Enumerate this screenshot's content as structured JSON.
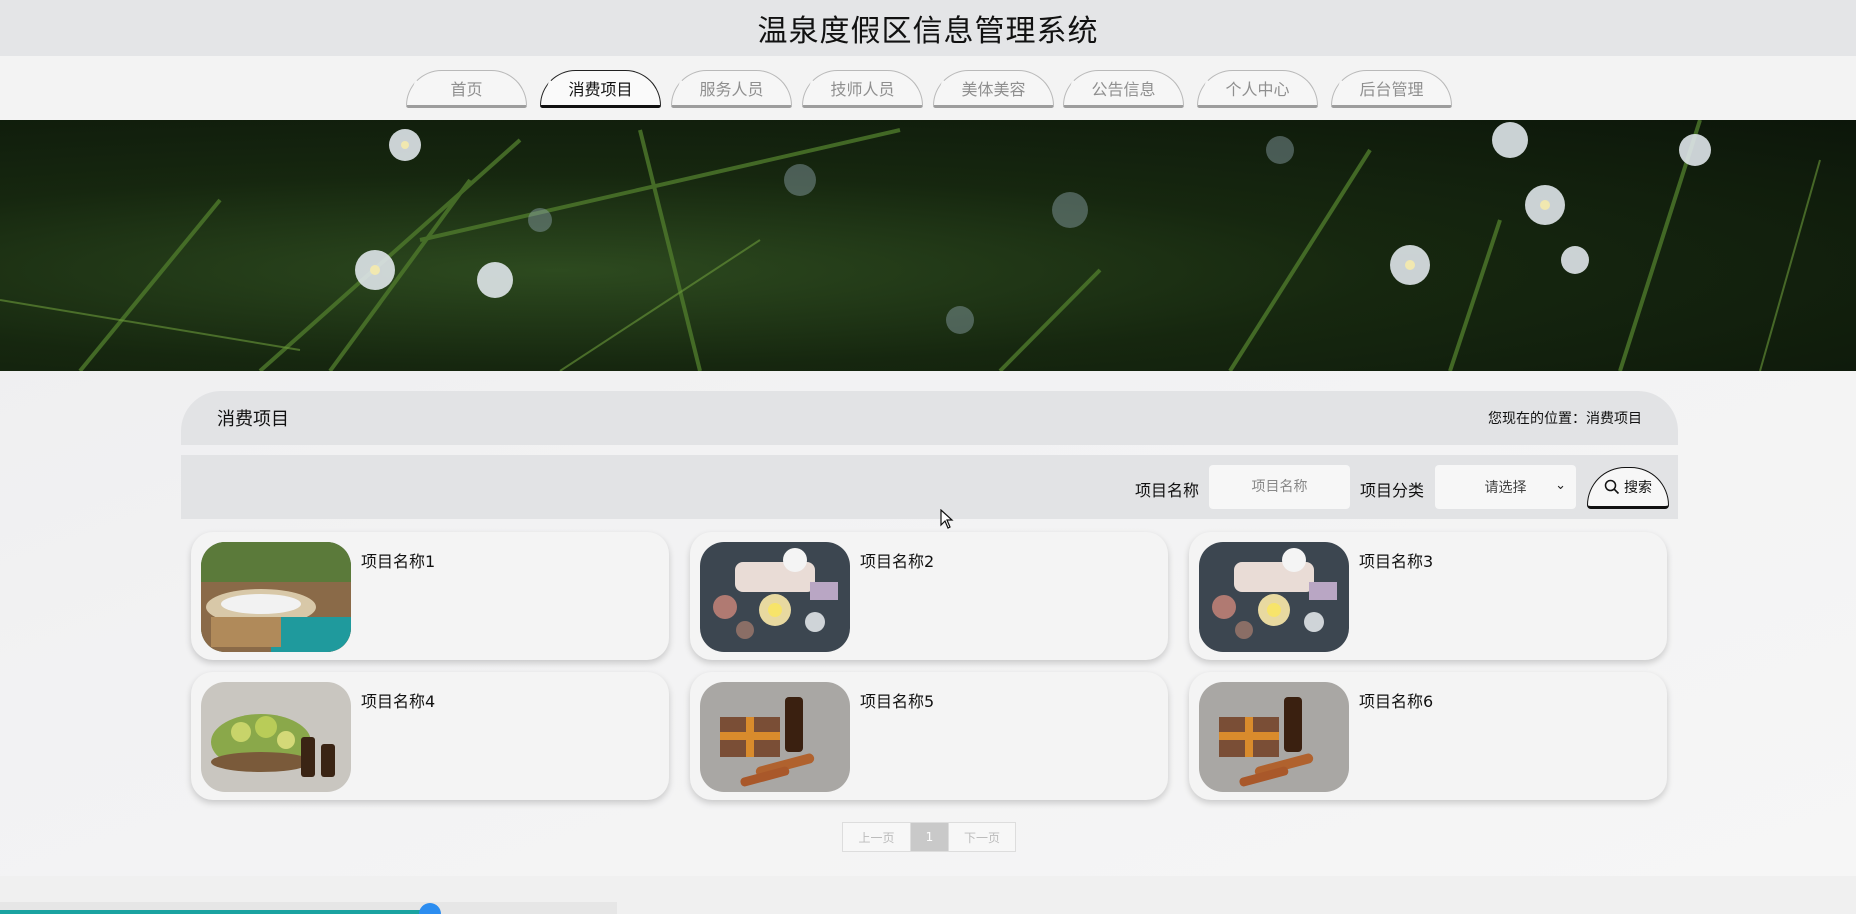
{
  "header": {
    "title": "温泉度假区信息管理系统"
  },
  "nav": {
    "items": [
      {
        "label": "首页",
        "active": false
      },
      {
        "label": "消费项目",
        "active": true
      },
      {
        "label": "服务人员",
        "active": false
      },
      {
        "label": "技师人员",
        "active": false
      },
      {
        "label": "美体美容",
        "active": false
      },
      {
        "label": "公告信息",
        "active": false
      },
      {
        "label": "个人中心",
        "active": false
      },
      {
        "label": "后台管理",
        "active": false
      }
    ]
  },
  "section": {
    "title": "消费项目",
    "breadcrumb_prefix": "您现在的位置：",
    "breadcrumb_current": "消费项目"
  },
  "search": {
    "name_label": "项目名称",
    "name_placeholder": "项目名称",
    "category_label": "项目分类",
    "category_value": "请选择",
    "button_label": "搜索"
  },
  "items": [
    {
      "name": "项目名称1",
      "image": "hot-spring-pool"
    },
    {
      "name": "项目名称2",
      "image": "spa-stones-candles"
    },
    {
      "name": "项目名称3",
      "image": "spa-stones-candles"
    },
    {
      "name": "项目名称4",
      "image": "herbs-essential-oils"
    },
    {
      "name": "项目名称5",
      "image": "soap-cinnamon-oil"
    },
    {
      "name": "项目名称6",
      "image": "soap-cinnamon-oil"
    }
  ],
  "pagination": {
    "prev": "上一页",
    "current": "1",
    "next": "下一页"
  },
  "colors": {
    "accent_teal": "#1aa3a1",
    "handle_blue": "#2c8df0",
    "active_nav": "#111111"
  }
}
